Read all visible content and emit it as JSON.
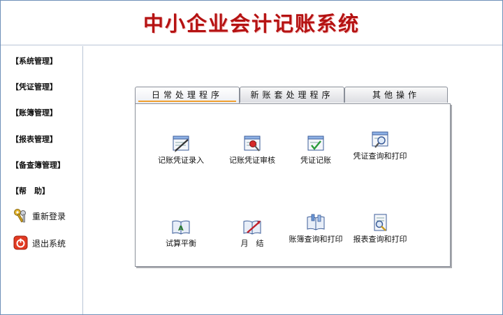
{
  "header": {
    "title": "中小企业会计记账系统"
  },
  "sidebar": {
    "items": [
      {
        "label": "【系统管理】"
      },
      {
        "label": "【凭证管理】"
      },
      {
        "label": "【账簿管理】"
      },
      {
        "label": "【报表管理】"
      },
      {
        "label": "【备查簿管理】"
      },
      {
        "label": "【帮　助】"
      }
    ],
    "relogin": {
      "label": "重新登录",
      "icon": "keys-icon"
    },
    "exit": {
      "label": "退出系统",
      "icon": "power-icon"
    }
  },
  "tabs": [
    {
      "label": "日常处理程序",
      "active": true
    },
    {
      "label": "新账套处理程序",
      "active": false
    },
    {
      "label": "其他操作",
      "active": false
    }
  ],
  "launchers": [
    {
      "label": "记账凭证录入",
      "icon": "voucher-entry-icon"
    },
    {
      "label": "记账凭证审核",
      "icon": "voucher-review-icon"
    },
    {
      "label": "凭证记账",
      "icon": "voucher-posting-icon"
    },
    {
      "label": "凭证查询和打印",
      "icon": "voucher-query-icon"
    },
    {
      "label": "试算平衡",
      "icon": "trial-balance-icon"
    },
    {
      "label": "月　结",
      "icon": "month-end-icon"
    },
    {
      "label": "账簿查询和打印",
      "icon": "ledger-query-icon"
    },
    {
      "label": "报表查询和打印",
      "icon": "report-query-icon"
    }
  ],
  "colors": {
    "title": "#b51212",
    "border": "#8a8f99",
    "tab_accent": "#f0a030"
  }
}
